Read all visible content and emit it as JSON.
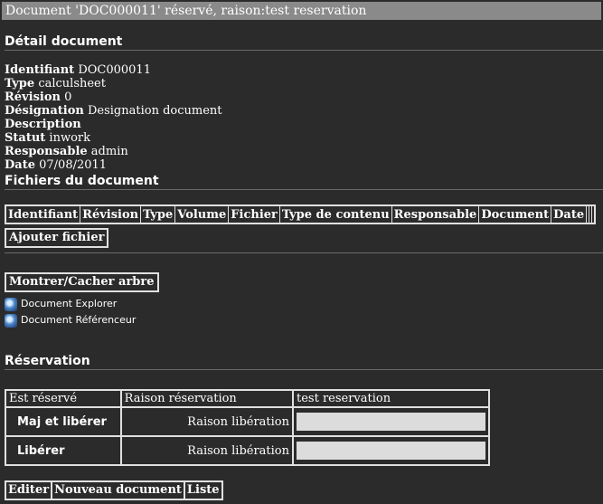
{
  "window": {
    "title": "Document 'DOC000011' réservé, raison:test reservation"
  },
  "detail": {
    "heading": "Détail document",
    "fields": [
      {
        "label": "Identifiant",
        "value": "DOC000011"
      },
      {
        "label": "Type",
        "value": "calculsheet"
      },
      {
        "label": "Révision",
        "value": "0"
      },
      {
        "label": "Désignation",
        "value": "Designation document"
      },
      {
        "label": "Description",
        "value": ""
      },
      {
        "label": "Statut",
        "value": "inwork"
      },
      {
        "label": "Responsable",
        "value": "admin"
      },
      {
        "label": "Date",
        "value": "07/08/2011"
      }
    ]
  },
  "files": {
    "heading": "Fichiers du document",
    "columns": [
      "Identifiant",
      "Révision",
      "Type",
      "Volume",
      "Fichier",
      "Type de contenu",
      "Responsable",
      "Document",
      "Date",
      "",
      "",
      ""
    ],
    "add_label": "Ajouter fichier"
  },
  "tree": {
    "toggle_label": "Montrer/Cacher arbre",
    "links": [
      {
        "label": "Document Explorer",
        "icon": "globe-icon"
      },
      {
        "label": "Document Référenceur",
        "icon": "globe-icon"
      }
    ]
  },
  "reservation": {
    "heading": "Réservation",
    "header": [
      "Est réservé",
      "Raison réservation",
      "test reservation"
    ],
    "rows": [
      {
        "action": "Maj et libérer",
        "label": "Raison libération",
        "value": ""
      },
      {
        "action": "Libérer",
        "label": "Raison libération",
        "value": ""
      }
    ]
  },
  "actions": [
    "Editer",
    "Nouveau document",
    "Liste"
  ]
}
